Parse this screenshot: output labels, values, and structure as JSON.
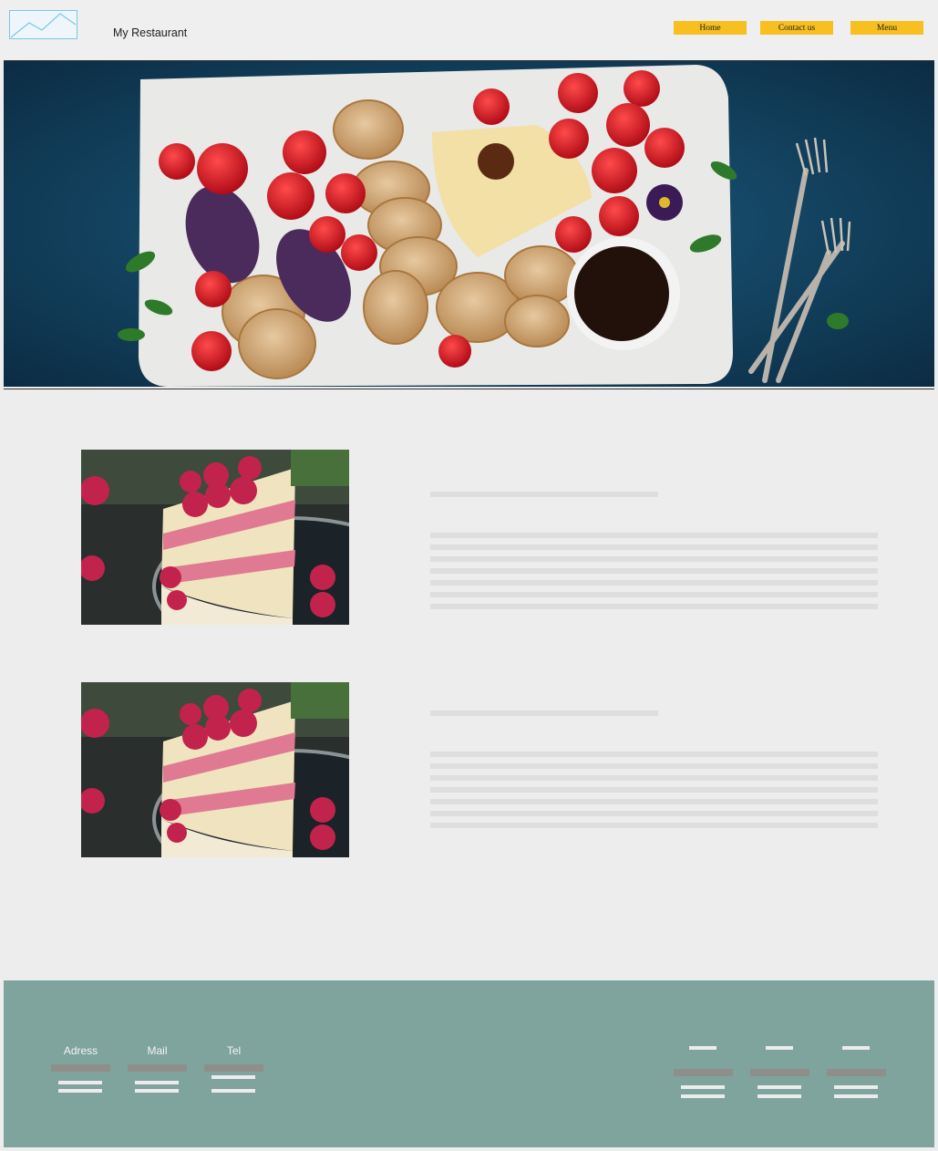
{
  "header": {
    "logo_icon": "image-placeholder-icon",
    "brand": "My Restaurant",
    "nav": [
      {
        "label": "Home"
      },
      {
        "label": "Contact us"
      },
      {
        "label": "Menu"
      }
    ],
    "nav_color": "#f7bf1f"
  },
  "hero": {
    "image": "charcuterie-board-photo"
  },
  "sections": [
    {
      "image": "raspberry-cake-photo"
    },
    {
      "image": "raspberry-cake-photo"
    }
  ],
  "footer": {
    "background": "#7fa39d",
    "contacts": [
      {
        "label": "Adress"
      },
      {
        "label": "Mail"
      },
      {
        "label": "Tel"
      }
    ]
  }
}
